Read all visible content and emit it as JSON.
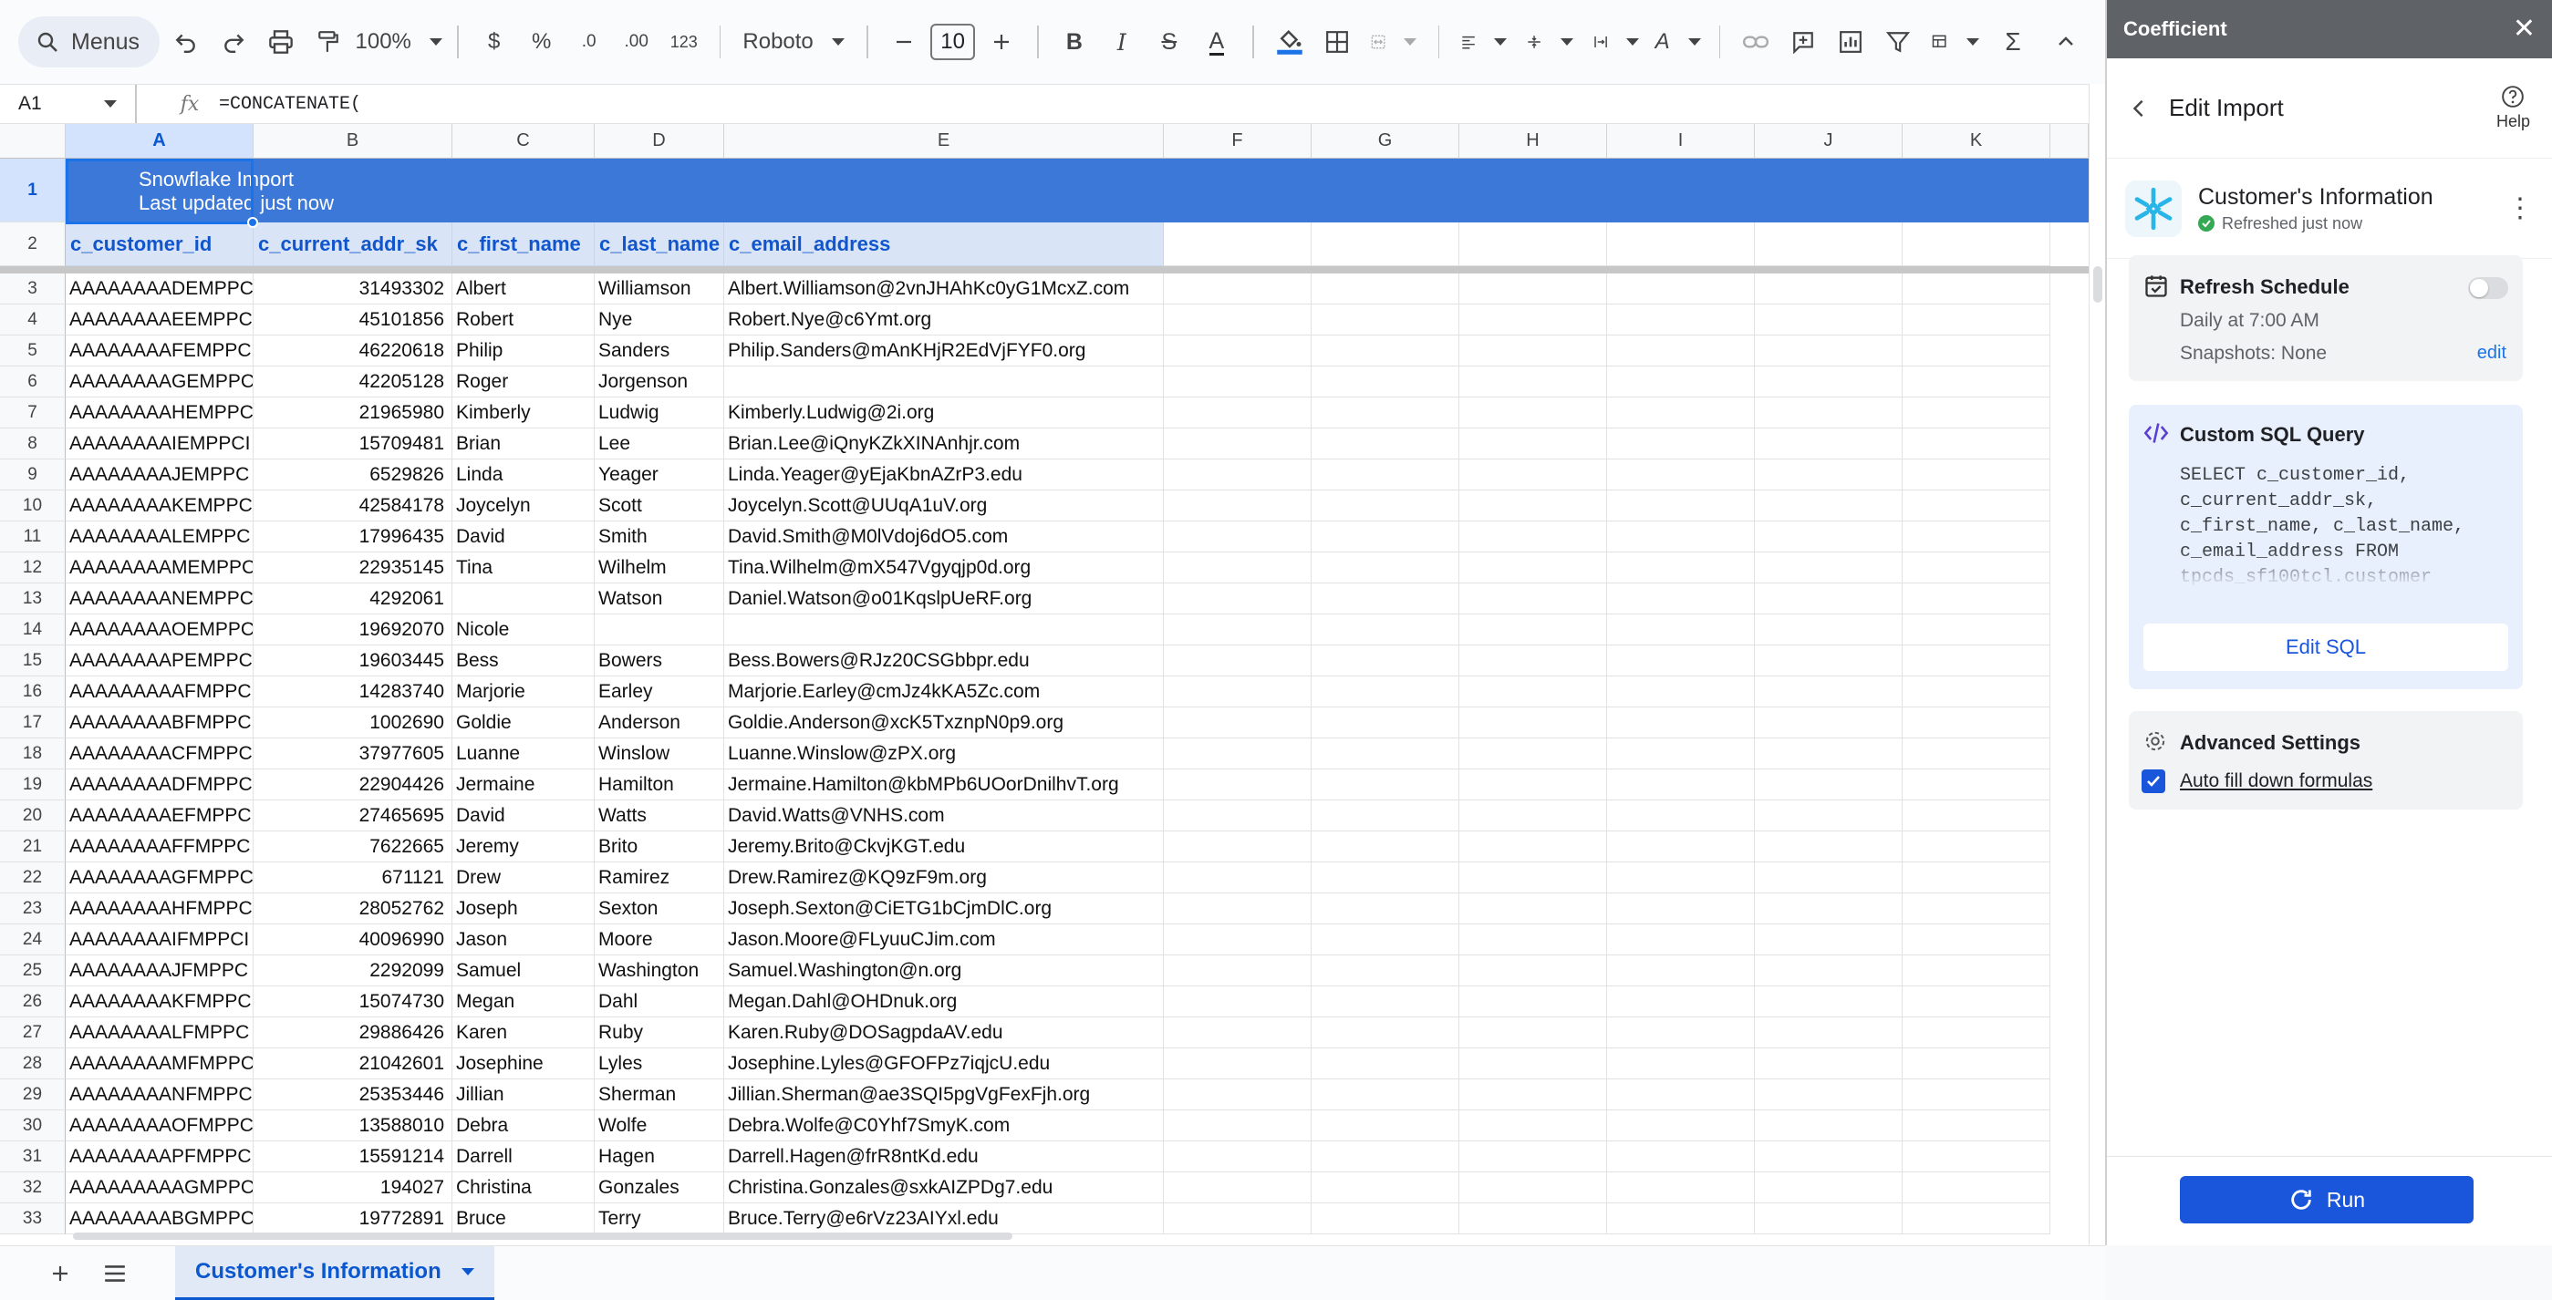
{
  "toolbar": {
    "menus_label": "Menus",
    "zoom": "100%",
    "currency": "$",
    "percent": "%",
    "decrease_decimals": ".0",
    "increase_decimals": ".00",
    "number_format": "123",
    "font": "Roboto",
    "font_size": "10"
  },
  "formula_bar": {
    "cell_ref": "A1",
    "formula": "=CONCATENATE("
  },
  "columns": [
    "A",
    "B",
    "C",
    "D",
    "E",
    "F",
    "G",
    "H",
    "I",
    "J",
    "K"
  ],
  "banner": {
    "line1": "Snowflake Import",
    "line2": "Last updated just now"
  },
  "headers": [
    "c_customer_id",
    "c_current_addr_sk",
    "c_first_name",
    "c_last_name",
    "c_email_address"
  ],
  "rows": [
    {
      "n": "3",
      "id": "AAAAAAAADEMPPC",
      "addr": "31493302",
      "first": "Albert",
      "last": "Williamson",
      "email": "Albert.Williamson@2vnJHAhKc0yG1McxZ.com"
    },
    {
      "n": "4",
      "id": "AAAAAAAAEEMPPC",
      "addr": "45101856",
      "first": "Robert",
      "last": "Nye",
      "email": "Robert.Nye@c6Ymt.org"
    },
    {
      "n": "5",
      "id": "AAAAAAAAFEMPPC",
      "addr": "46220618",
      "first": "Philip",
      "last": "Sanders",
      "email": "Philip.Sanders@mAnKHjR2EdVjFYF0.org"
    },
    {
      "n": "6",
      "id": "AAAAAAAAGEMPPC",
      "addr": "42205128",
      "first": "Roger",
      "last": "Jorgenson",
      "email": ""
    },
    {
      "n": "7",
      "id": "AAAAAAAAHEMPPC",
      "addr": "21965980",
      "first": "Kimberly",
      "last": "Ludwig",
      "email": "Kimberly.Ludwig@2i.org"
    },
    {
      "n": "8",
      "id": "AAAAAAAAIEMPPCI",
      "addr": "15709481",
      "first": "Brian",
      "last": "Lee",
      "email": "Brian.Lee@iQnyKZkXINAnhjr.com"
    },
    {
      "n": "9",
      "id": "AAAAAAAAJEMPPC",
      "addr": "6529826",
      "first": "Linda",
      "last": "Yeager",
      "email": "Linda.Yeager@yEjaKbnAZrP3.edu"
    },
    {
      "n": "10",
      "id": "AAAAAAAAKEMPPC",
      "addr": "42584178",
      "first": "Joycelyn",
      "last": "Scott",
      "email": "Joycelyn.Scott@UUqA1uV.org"
    },
    {
      "n": "11",
      "id": "AAAAAAAALEMPPC",
      "addr": "17996435",
      "first": "David",
      "last": "Smith",
      "email": "David.Smith@M0lVdoj6dO5.com"
    },
    {
      "n": "12",
      "id": "AAAAAAAAMEMPPC",
      "addr": "22935145",
      "first": "Tina",
      "last": "Wilhelm",
      "email": "Tina.Wilhelm@mX547Vgyqjp0d.org"
    },
    {
      "n": "13",
      "id": "AAAAAAAANEMPPC",
      "addr": "4292061",
      "first": "",
      "last": "Watson",
      "email": "Daniel.Watson@o01KqslpUeRF.org"
    },
    {
      "n": "14",
      "id": "AAAAAAAAOEMPPC",
      "addr": "19692070",
      "first": "Nicole",
      "last": "",
      "email": ""
    },
    {
      "n": "15",
      "id": "AAAAAAAAPEMPPC",
      "addr": "19603445",
      "first": "Bess",
      "last": "Bowers",
      "email": "Bess.Bowers@RJz20CSGbbpr.edu"
    },
    {
      "n": "16",
      "id": "AAAAAAAAAFMPPC",
      "addr": "14283740",
      "first": "Marjorie",
      "last": "Earley",
      "email": "Marjorie.Earley@cmJz4kKA5Zc.com"
    },
    {
      "n": "17",
      "id": "AAAAAAAABFMPPC",
      "addr": "1002690",
      "first": "Goldie",
      "last": "Anderson",
      "email": "Goldie.Anderson@xcK5TxznpN0p9.org"
    },
    {
      "n": "18",
      "id": "AAAAAAAACFMPPC",
      "addr": "37977605",
      "first": "Luanne",
      "last": "Winslow",
      "email": "Luanne.Winslow@zPX.org"
    },
    {
      "n": "19",
      "id": "AAAAAAAADFMPPC",
      "addr": "22904426",
      "first": "Jermaine",
      "last": "Hamilton",
      "email": "Jermaine.Hamilton@kbMPb6UOorDnilhvT.org"
    },
    {
      "n": "20",
      "id": "AAAAAAAAEFMPPC",
      "addr": "27465695",
      "first": "David",
      "last": "Watts",
      "email": "David.Watts@VNHS.com"
    },
    {
      "n": "21",
      "id": "AAAAAAAAFFMPPC",
      "addr": "7622665",
      "first": "Jeremy",
      "last": "Brito",
      "email": "Jeremy.Brito@CkvjKGT.edu"
    },
    {
      "n": "22",
      "id": "AAAAAAAAGFMPPC",
      "addr": "671121",
      "first": "Drew",
      "last": "Ramirez",
      "email": "Drew.Ramirez@KQ9zF9m.org"
    },
    {
      "n": "23",
      "id": "AAAAAAAAHFMPPC",
      "addr": "28052762",
      "first": "Joseph",
      "last": "Sexton",
      "email": "Joseph.Sexton@CiETG1bCjmDlC.org"
    },
    {
      "n": "24",
      "id": "AAAAAAAAIFMPPCI",
      "addr": "40096990",
      "first": "Jason",
      "last": "Moore",
      "email": "Jason.Moore@FLyuuCJim.com"
    },
    {
      "n": "25",
      "id": "AAAAAAAAJFMPPC",
      "addr": "2292099",
      "first": "Samuel",
      "last": "Washington",
      "email": "Samuel.Washington@n.org"
    },
    {
      "n": "26",
      "id": "AAAAAAAAKFMPPC",
      "addr": "15074730",
      "first": "Megan",
      "last": "Dahl",
      "email": "Megan.Dahl@OHDnuk.org"
    },
    {
      "n": "27",
      "id": "AAAAAAAALFMPPC",
      "addr": "29886426",
      "first": "Karen",
      "last": "Ruby",
      "email": "Karen.Ruby@DOSagpdaAV.edu"
    },
    {
      "n": "28",
      "id": "AAAAAAAAMFMPPC",
      "addr": "21042601",
      "first": "Josephine",
      "last": "Lyles",
      "email": "Josephine.Lyles@GFOFPz7iqjcU.edu"
    },
    {
      "n": "29",
      "id": "AAAAAAAANFMPPC",
      "addr": "25353446",
      "first": "Jillian",
      "last": "Sherman",
      "email": "Jillian.Sherman@ae3SQI5pgVgFexFjh.org"
    },
    {
      "n": "30",
      "id": "AAAAAAAAOFMPPC",
      "addr": "13588010",
      "first": "Debra",
      "last": "Wolfe",
      "email": "Debra.Wolfe@C0Yhf7SmyK.com"
    },
    {
      "n": "31",
      "id": "AAAAAAAAPFMPPC",
      "addr": "15591214",
      "first": "Darrell",
      "last": "Hagen",
      "email": "Darrell.Hagen@frR8ntKd.edu"
    },
    {
      "n": "32",
      "id": "AAAAAAAAAGMPPC",
      "addr": "194027",
      "first": "Christina",
      "last": "Gonzales",
      "email": "Christina.Gonzales@sxkAIZPDg7.edu"
    },
    {
      "n": "33",
      "id": "AAAAAAAABGMPPC",
      "addr": "19772891",
      "first": "Bruce",
      "last": "Terry",
      "email": "Bruce.Terry@e6rVz23AIYxl.edu"
    }
  ],
  "sheet_tab": "Customer's Information",
  "panel": {
    "title": "Coefficient",
    "heading": "Edit Import",
    "help": "Help",
    "source_name": "Customer's Information",
    "source_status": "Refreshed just now",
    "refresh": {
      "title": "Refresh Schedule",
      "schedule": "Daily at 7:00 AM",
      "snapshots": "Snapshots: None",
      "edit": "edit"
    },
    "sql": {
      "title": "Custom SQL Query",
      "query": "SELECT c_customer_id,\nc_current_addr_sk,\nc_first_name, c_last_name,\nc_email_address FROM\ntpcds_sf100tcl.customer",
      "edit_button": "Edit SQL"
    },
    "advanced": {
      "title": "Advanced Settings",
      "autofill": "Auto fill down formulas"
    },
    "run_button": "Run"
  },
  "colors": {
    "accent": "#1a56db",
    "banner": "#3c78d8",
    "header_fill": "#d9e5f7"
  }
}
